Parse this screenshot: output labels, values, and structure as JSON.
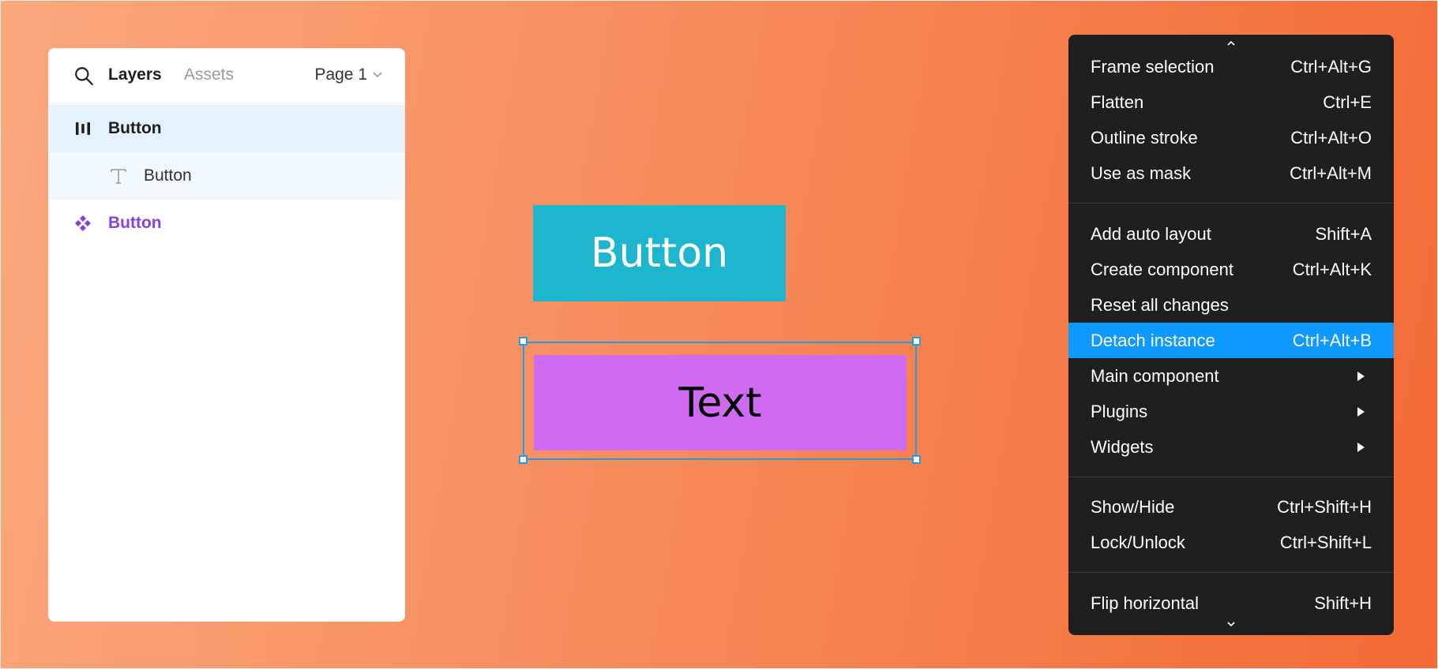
{
  "layers_panel": {
    "tabs": {
      "layers": "Layers",
      "assets": "Assets"
    },
    "page_selector": "Page 1",
    "rows": [
      {
        "label": "Button",
        "icon": "frame-autolayout-icon",
        "state": "selected"
      },
      {
        "label": "Button",
        "icon": "text-layer-icon",
        "state": "child-selected"
      },
      {
        "label": "Button",
        "icon": "component-icon",
        "state": "component"
      }
    ]
  },
  "canvas": {
    "button_label": "Button",
    "text_block_label": "Text"
  },
  "context_menu": {
    "groups": [
      [
        {
          "label": "Frame selection",
          "shortcut": "Ctrl+Alt+G"
        },
        {
          "label": "Flatten",
          "shortcut": "Ctrl+E"
        },
        {
          "label": "Outline stroke",
          "shortcut": "Ctrl+Alt+O"
        },
        {
          "label": "Use as mask",
          "shortcut": "Ctrl+Alt+M"
        }
      ],
      [
        {
          "label": "Add auto layout",
          "shortcut": "Shift+A"
        },
        {
          "label": "Create component",
          "shortcut": "Ctrl+Alt+K"
        },
        {
          "label": "Reset all changes",
          "shortcut": ""
        },
        {
          "label": "Detach instance",
          "shortcut": "Ctrl+Alt+B",
          "highlighted": true
        },
        {
          "label": "Main component",
          "submenu": true
        },
        {
          "label": "Plugins",
          "submenu": true
        },
        {
          "label": "Widgets",
          "submenu": true
        }
      ],
      [
        {
          "label": "Show/Hide",
          "shortcut": "Ctrl+Shift+H"
        },
        {
          "label": "Lock/Unlock",
          "shortcut": "Ctrl+Shift+L"
        }
      ],
      [
        {
          "label": "Flip horizontal",
          "shortcut": "Shift+H"
        }
      ]
    ]
  },
  "colors": {
    "menu_highlight": "#0d99ff",
    "selection_blue": "#1f9ee8",
    "button_fill": "#1eb6ce",
    "text_block_fill": "#cf6bf2",
    "component_purple": "#8c3fd8"
  }
}
